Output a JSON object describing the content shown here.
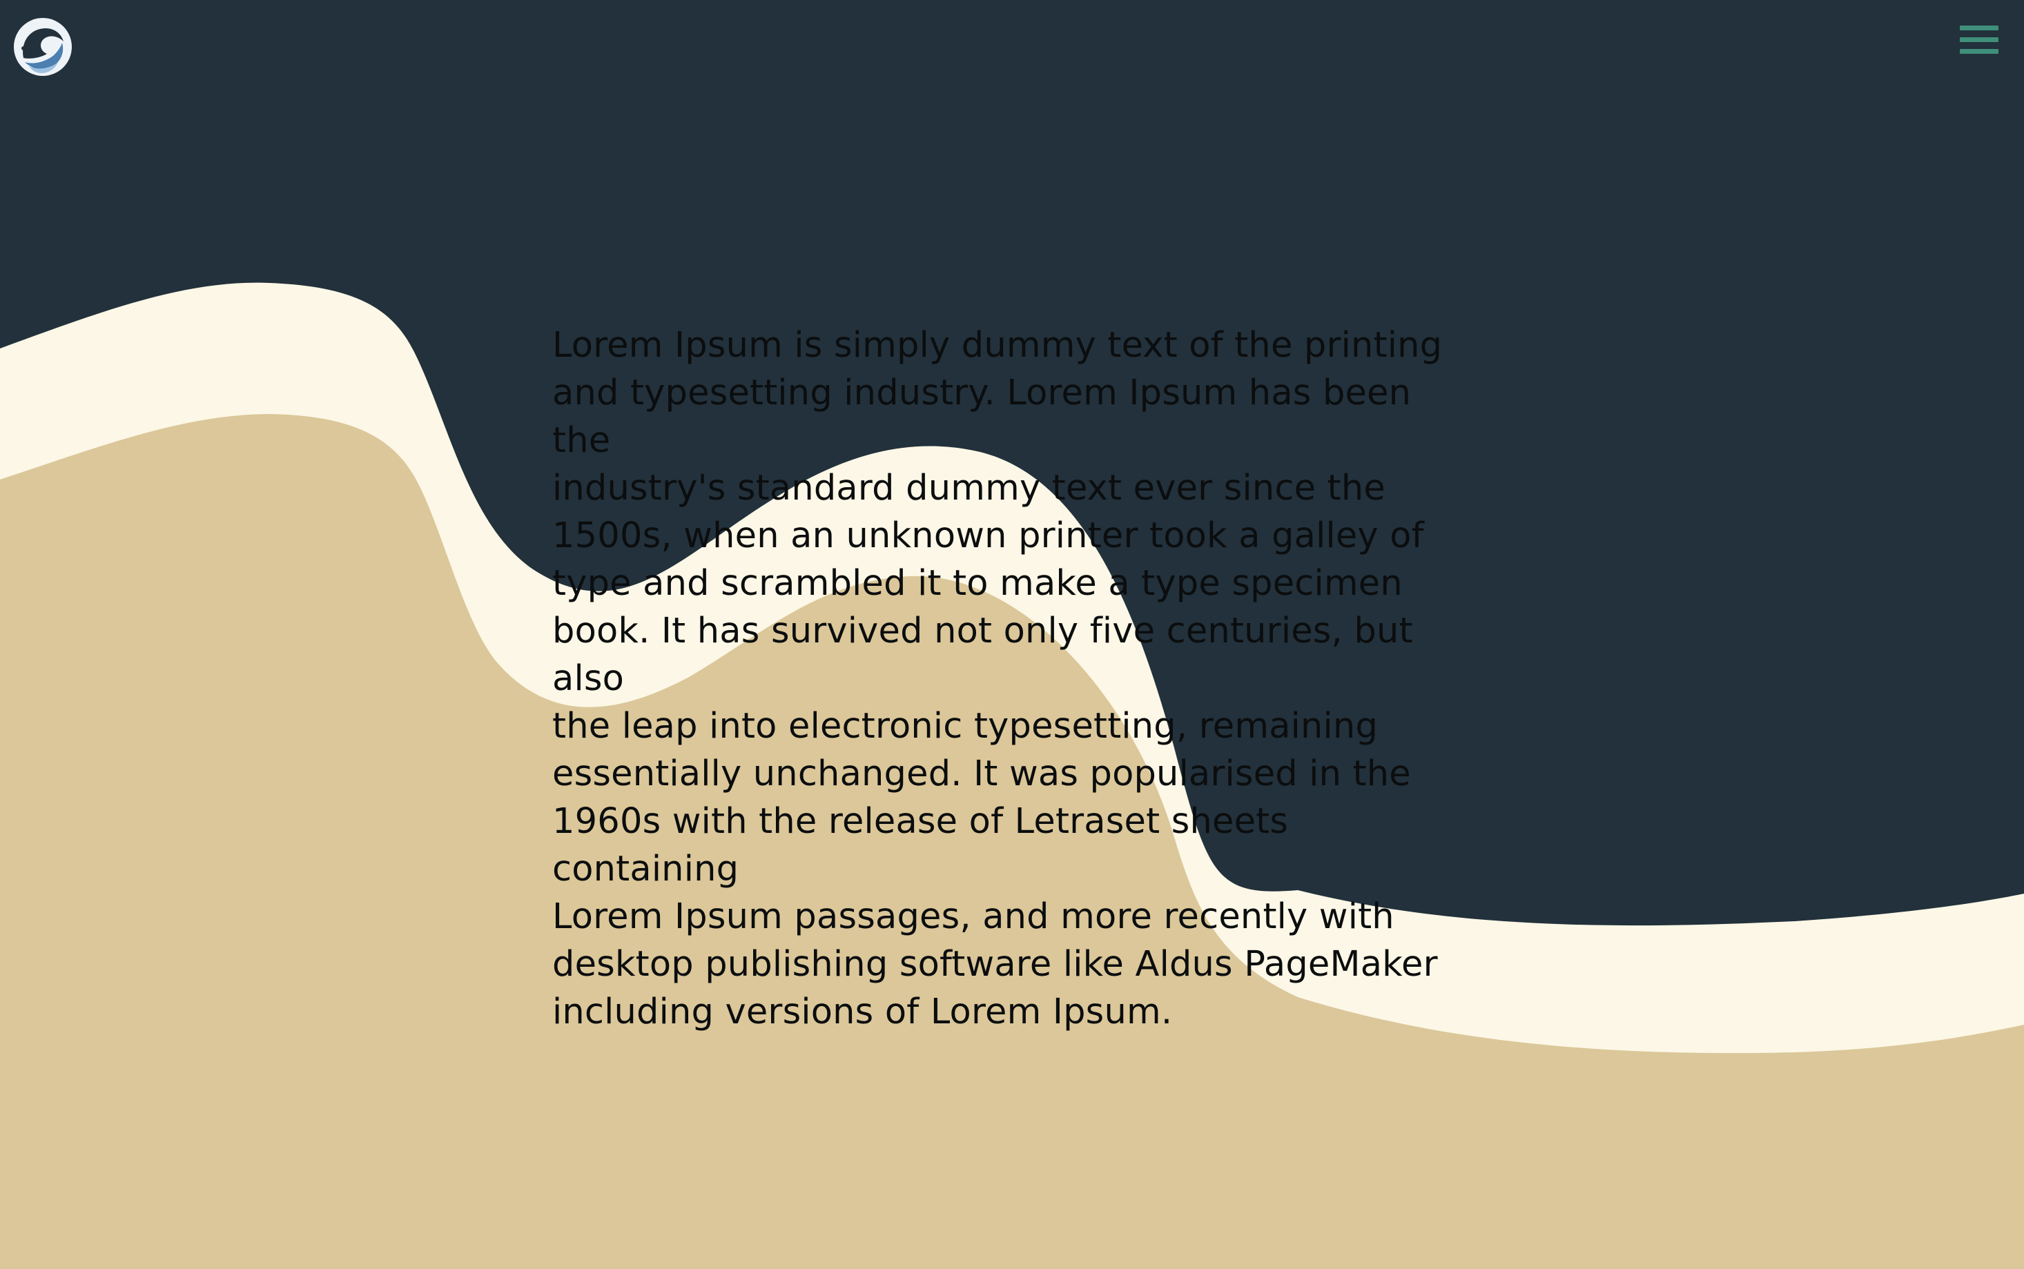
{
  "colors": {
    "background": "#22313b",
    "cream": "#fcf7e6",
    "sand": "#dbc799",
    "accent": "#3f8f7a",
    "text": "#0b0d0e"
  },
  "header": {
    "logo_icon": "wave-logo-icon",
    "menu_icon": "hamburger-menu-icon"
  },
  "main": {
    "text": "Lorem Ipsum is simply dummy text of the printing\nand typesetting industry. Lorem Ipsum has been the\nindustry's standard dummy text ever since the\n1500s, when an unknown printer took a galley of\ntype and scrambled it to make a type specimen\nbook. It has survived not only five centuries, but also\nthe leap into electronic typesetting, remaining\nessentially unchanged. It was popularised in the\n1960s with the release of Letraset sheets containing\nLorem Ipsum passages, and more recently with\ndesktop publishing software like Aldus PageMaker\nincluding versions of Lorem Ipsum."
  }
}
